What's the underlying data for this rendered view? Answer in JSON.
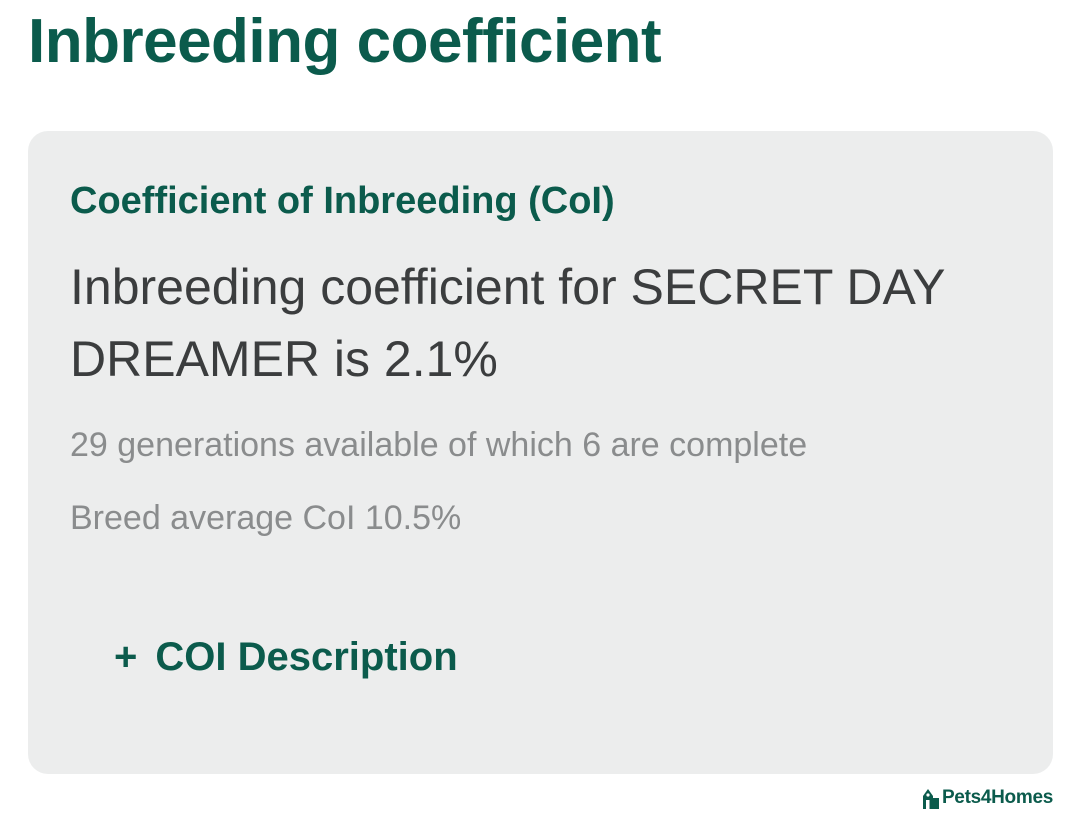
{
  "page": {
    "title": "Inbreeding coefficient"
  },
  "card": {
    "heading": "Coefficient of Inbreeding (CoI)",
    "result": "Inbreeding coefficient for SECRET DAY DREAMER is 2.1%",
    "generations": "29 generations available of which 6 are complete",
    "breed_average": "Breed average CoI 10.5%",
    "toggle": {
      "icon": "+",
      "label": "COI Description"
    }
  },
  "brand": {
    "name": "Pets4Homes",
    "icon": "pets4homes-logo-icon"
  },
  "colors": {
    "accent": "#0b5b4c",
    "card_background": "#eceded",
    "primary_text": "#3b3d3e",
    "secondary_text": "#8a8c8d"
  }
}
